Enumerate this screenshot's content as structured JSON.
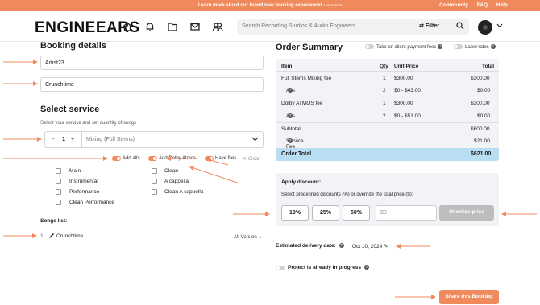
{
  "banner": {
    "message": "Learn more about our brand new booking experience!",
    "learn_more": "Learn more",
    "links": [
      "Community",
      "FAQ",
      "Help"
    ]
  },
  "header": {
    "logo": "ENGINEEARS",
    "search_placeholder": "Search Recording Studios & Audio Engineers",
    "filter_label": "Filter"
  },
  "booking": {
    "title": "Booking details",
    "artist": "Artist23",
    "project": "Crunchtime",
    "select_title": "Select service",
    "select_hint": "Select your service and set quantity of songs",
    "quantity": "1",
    "minus": "-",
    "plus": "+",
    "service": "Mixing (Full Stems)",
    "toggles": {
      "alts": "Add alts.",
      "atmos": "Add Dolby Atmos",
      "files": "Have files",
      "clear": "Clear"
    },
    "checkboxes": [
      "Main",
      "Instrumental",
      "Performance",
      "Clean Performance",
      "Clean",
      "A cappella",
      "Clean A cappella"
    ],
    "songs_title": "Songs list:",
    "song_number": "1.",
    "song_name": "Crunchtime",
    "alt_version": "Alt Version"
  },
  "order": {
    "title": "Order Summary",
    "take_fees": "Take on client payment fees",
    "label_rates": "Label rates",
    "headers": [
      "Item",
      "Qty",
      "Unit Price",
      "Total"
    ],
    "rows": [
      {
        "item": "Full Stems Mixing fee",
        "qty": "1",
        "unit": "$300.00",
        "total": "$300.00"
      },
      {
        "item": "Alts",
        "qty": "2",
        "unit": "$0 - $43.00",
        "total": "$0.00"
      },
      {
        "item": "Dolby ATMOS fee",
        "qty": "1",
        "unit": "$300.00",
        "total": "$300.00"
      },
      {
        "item": "Alts",
        "qty": "2",
        "unit": "$0 - $51.00",
        "total": "$0.00"
      }
    ],
    "subtotal_label": "Subtotal",
    "subtotal": "$600.00",
    "service_fee_label": "Service Fee",
    "service_fee": "$21.00",
    "total_label": "Order Total",
    "total": "$621.00"
  },
  "discount": {
    "title": "Apply discount:",
    "hint": "Select predefined discounts (%) or override the total price ($):",
    "options": [
      "10%",
      "25%",
      "50%"
    ],
    "input_placeholder": "$0",
    "override": "Override price"
  },
  "delivery": {
    "label": "Estimated delivery date:",
    "date": "Oct 10, 2024"
  },
  "progress_label": "Project is already in progress",
  "share_label": "Share this Booking",
  "colors": {
    "accent": "#f08a5d",
    "total_bg": "#b9ddf3"
  }
}
